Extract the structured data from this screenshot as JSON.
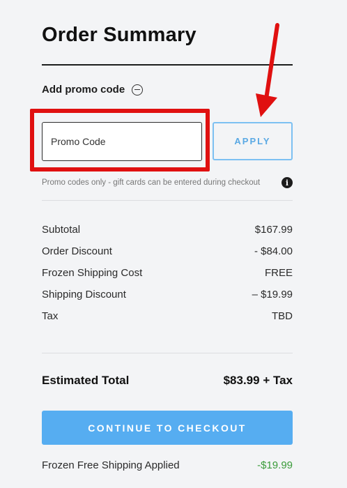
{
  "summary": {
    "title": "Order Summary"
  },
  "promo": {
    "toggle_label": "Add promo code",
    "toggle_icon": "minus-circle-icon",
    "input_placeholder": "Promo Code",
    "apply_label": "APPLY",
    "note": "Promo codes only - gift cards can be entered during checkout",
    "info_icon": "info-icon",
    "info_glyph": "i"
  },
  "line_items": [
    {
      "label": "Subtotal",
      "value": "$167.99"
    },
    {
      "label": "Order Discount",
      "value": "- $84.00"
    },
    {
      "label": "Frozen Shipping Cost",
      "value": "FREE"
    },
    {
      "label": "Shipping Discount",
      "value": "– $19.99"
    },
    {
      "label": "Tax",
      "value": "TBD"
    }
  ],
  "total": {
    "label": "Estimated Total",
    "value": "$83.99 + Tax"
  },
  "checkout": {
    "label": "CONTINUE TO CHECKOUT"
  },
  "shipping_applied": {
    "label": "Frozen Free Shipping Applied",
    "value": "-$19.99"
  },
  "colors": {
    "annotation_red": "#e01010",
    "accent_blue": "#56adf1",
    "discount_green": "#3a9b3a"
  }
}
